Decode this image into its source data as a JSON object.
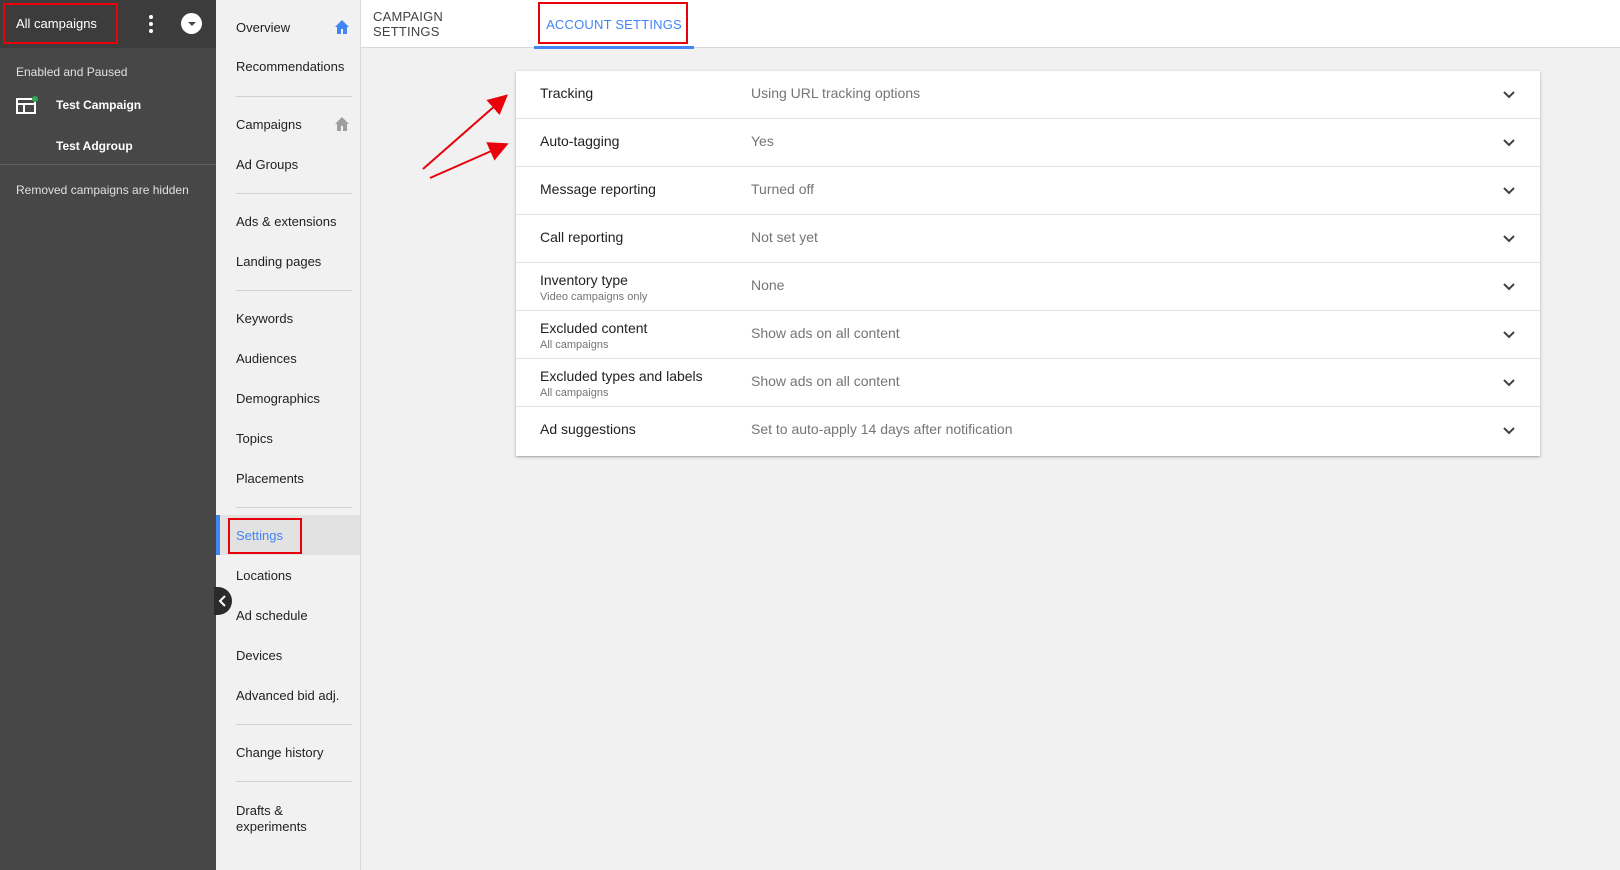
{
  "tree": {
    "all_campaigns": "All campaigns",
    "filter_status": "Enabled and Paused",
    "campaign": "Test Campaign",
    "adgroup": "Test Adgroup",
    "hidden_note": "Removed campaigns are hidden"
  },
  "nav": {
    "items": [
      {
        "label": "Overview",
        "icon": "home-icon"
      },
      {
        "label": "Recommendations"
      },
      {
        "label": "Campaigns",
        "icon": "home-icon"
      },
      {
        "label": "Ad Groups"
      },
      {
        "label": "Ads & extensions"
      },
      {
        "label": "Landing pages"
      },
      {
        "label": "Keywords"
      },
      {
        "label": "Audiences"
      },
      {
        "label": "Demographics"
      },
      {
        "label": "Topics"
      },
      {
        "label": "Placements"
      },
      {
        "label": "Settings",
        "active": true
      },
      {
        "label": "Locations"
      },
      {
        "label": "Ad schedule"
      },
      {
        "label": "Devices"
      },
      {
        "label": "Advanced bid adj."
      },
      {
        "label": "Change history"
      },
      {
        "label": "Drafts &\nexperiments"
      }
    ]
  },
  "tabs": {
    "campaign": "CAMPAIGN SETTINGS",
    "account": "ACCOUNT SETTINGS"
  },
  "settings": [
    {
      "name": "Tracking",
      "value": "Using URL tracking options"
    },
    {
      "name": "Auto-tagging",
      "value": "Yes"
    },
    {
      "name": "Message reporting",
      "value": "Turned off"
    },
    {
      "name": "Call reporting",
      "value": "Not set yet"
    },
    {
      "name": "Inventory type",
      "sub": "Video campaigns only",
      "value": "None"
    },
    {
      "name": "Excluded content",
      "sub": "All campaigns",
      "value": "Show ads on all content"
    },
    {
      "name": "Excluded types and labels",
      "sub": "All campaigns",
      "value": "Show ads on all content"
    },
    {
      "name": "Ad suggestions",
      "value": "Set to auto-apply 14 days after notification"
    }
  ],
  "colors": {
    "accent": "#4285f4",
    "highlight": "#e8000b",
    "tree_bg": "#474747"
  }
}
